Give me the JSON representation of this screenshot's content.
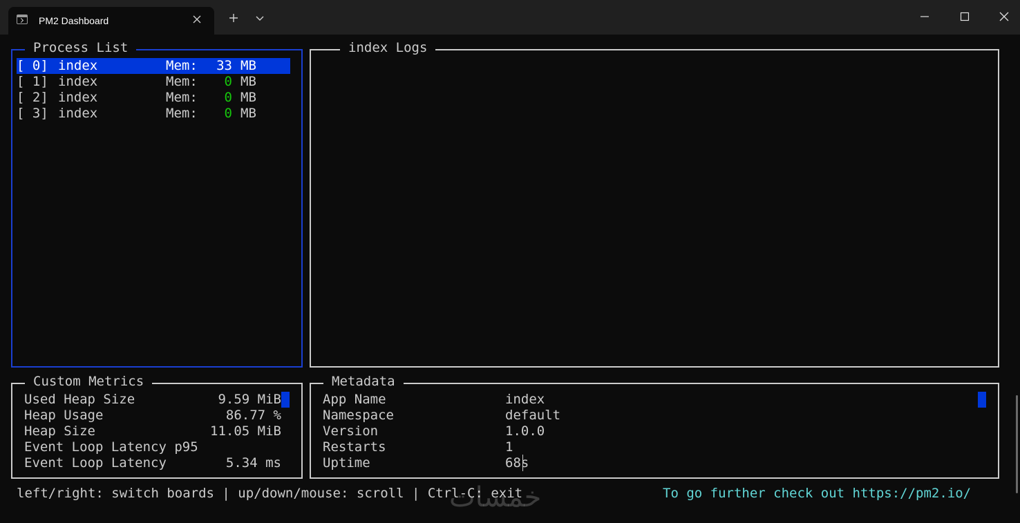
{
  "window": {
    "tab_title": "PM2 Dashboard",
    "icons": {
      "tab": "terminal-icon",
      "close_tab": "close-icon",
      "new_tab": "plus-icon",
      "dropdown": "chevron-down-icon",
      "minimize": "minimize-icon",
      "maximize": "maximize-icon",
      "close": "close-icon"
    }
  },
  "process_list": {
    "title": "Process List",
    "rows": [
      {
        "id": "[ 0]",
        "name": "index",
        "mem_label": "Mem:",
        "mem_value": "33",
        "unit": "MB",
        "selected": true
      },
      {
        "id": "[ 1]",
        "name": "index",
        "mem_label": "Mem:",
        "mem_value": "0",
        "unit": "MB",
        "selected": false
      },
      {
        "id": "[ 2]",
        "name": "index",
        "mem_label": "Mem:",
        "mem_value": "0",
        "unit": "MB",
        "selected": false
      },
      {
        "id": "[ 3]",
        "name": "index",
        "mem_label": "Mem:",
        "mem_value": "0",
        "unit": "MB",
        "selected": false
      }
    ]
  },
  "logs": {
    "title": "index Logs"
  },
  "custom_metrics": {
    "title": "Custom Metrics",
    "rows": [
      {
        "label": "Used Heap Size",
        "value": "9.59 MiB"
      },
      {
        "label": "Heap Usage",
        "value": "86.77 %"
      },
      {
        "label": "Heap Size",
        "value": "11.05 MiB"
      },
      {
        "label": "Event Loop Latency p95",
        "value": ""
      },
      {
        "label": "Event Loop Latency",
        "value": "5.34 ms"
      }
    ]
  },
  "metadata": {
    "title": "Metadata",
    "rows": [
      {
        "label": "App Name",
        "value": "index"
      },
      {
        "label": "Namespace",
        "value": "default"
      },
      {
        "label": "Version",
        "value": "1.0.0"
      },
      {
        "label": "Restarts",
        "value": "1"
      },
      {
        "label": "Uptime",
        "value": "68s"
      }
    ]
  },
  "footer": {
    "help": "left/right: switch boards | up/down/mouse: scroll | Ctrl-C: exit",
    "promo": "To go further check out https://pm2.io/"
  },
  "watermark": "خمسات",
  "colors": {
    "background": "#0c0c0c",
    "titlebar": "#202020",
    "selected_row": "#0037da",
    "focus_border": "#1a3fd1",
    "mem_value": "#16c60c",
    "promo_text": "#61d6d6"
  }
}
